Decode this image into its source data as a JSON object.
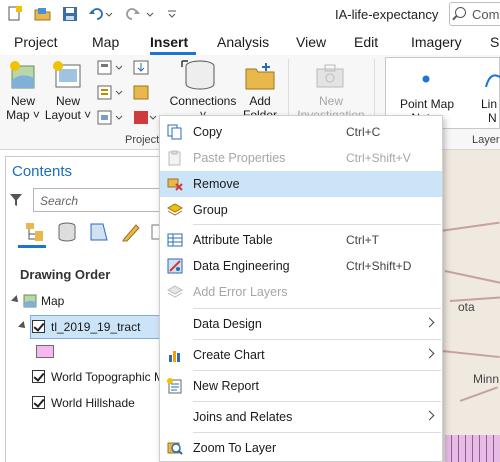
{
  "app": {
    "title": "IA-life-expectancy",
    "command_search_placeholder": "Com"
  },
  "ribbon_tabs": [
    {
      "label": "Project"
    },
    {
      "label": "Map"
    },
    {
      "label": "Insert"
    },
    {
      "label": "Analysis"
    },
    {
      "label": "View"
    },
    {
      "label": "Edit"
    },
    {
      "label": "Imagery"
    },
    {
      "label": "Sl"
    }
  ],
  "active_tab": "Insert",
  "ribbon": {
    "new_map": {
      "line1": "New",
      "line2": "Map ˅"
    },
    "new_layout": {
      "line1": "New",
      "line2": "Layout ˅"
    },
    "connections": "Connections ˅",
    "add_folder": {
      "line1": "Add",
      "line2": "Folder"
    },
    "new_investigation": {
      "line1": "New",
      "line2": "Investigation"
    },
    "point_map_notes": {
      "line1": "Point Map",
      "line2": "Notes"
    },
    "line_notes": {
      "line1": "Lin",
      "line2": "N"
    },
    "group_project": "Project",
    "group_layer": "Layer"
  },
  "contents": {
    "title": "Contents",
    "search_placeholder": "Search",
    "drawing_order": "Drawing Order",
    "layers": [
      {
        "label": "Map",
        "checked": false,
        "expanded": true
      },
      {
        "label": "tl_2019_19_tract",
        "checked": true,
        "expanded": true,
        "selected": true
      },
      {
        "label": "World Topographic M",
        "checked": true
      },
      {
        "label": "World Hillshade",
        "checked": true
      }
    ],
    "symbol_color": "#f7b8f0"
  },
  "map": {
    "labels": [
      "ota",
      "Minn"
    ]
  },
  "context_menu": {
    "items": [
      {
        "label": "Copy",
        "shortcut": "Ctrl+C",
        "icon": "copy-icon",
        "enabled": true
      },
      {
        "label": "Paste Properties",
        "shortcut": "Ctrl+Shift+V",
        "icon": "paste-properties-icon",
        "enabled": false
      },
      {
        "label": "Remove",
        "shortcut": "",
        "icon": "remove-icon",
        "enabled": true,
        "highlighted": true
      },
      {
        "label": "Group",
        "shortcut": "",
        "icon": "group-icon",
        "enabled": true
      },
      {
        "label": "Attribute Table",
        "shortcut": "Ctrl+T",
        "icon": "attribute-table-icon",
        "enabled": true
      },
      {
        "label": "Data Engineering",
        "shortcut": "Ctrl+Shift+D",
        "icon": "data-engineering-icon",
        "enabled": true
      },
      {
        "label": "Add Error Layers",
        "shortcut": "",
        "icon": "error-layers-icon",
        "enabled": false
      },
      {
        "label": "Data Design",
        "shortcut": "",
        "icon": "",
        "enabled": true,
        "submenu": true
      },
      {
        "label": "Create Chart",
        "shortcut": "",
        "icon": "chart-icon",
        "enabled": true,
        "submenu": true
      },
      {
        "label": "New Report",
        "shortcut": "",
        "icon": "report-icon",
        "enabled": true
      },
      {
        "label": "Joins and Relates",
        "shortcut": "",
        "icon": "",
        "enabled": true,
        "submenu": true
      },
      {
        "label": "Zoom To Layer",
        "shortcut": "",
        "icon": "zoom-to-layer-icon",
        "enabled": true
      }
    ]
  },
  "colors": {
    "accent": "#1a76d2",
    "highlight": "#cce4f7",
    "contents_title": "#1a6fb8"
  }
}
